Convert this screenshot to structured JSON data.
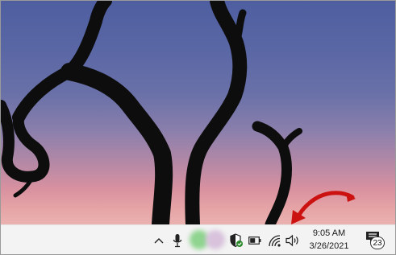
{
  "taskbar": {
    "clock_time": "9:05 AM",
    "clock_date": "3/26/2021",
    "notification_count": "23"
  },
  "icons": {
    "overflow": "chevron-up-icon",
    "microphone": "microphone-icon",
    "security": "shield-icon",
    "battery": "battery-icon",
    "network": "wifi-icon",
    "volume": "speaker-icon",
    "notifications": "notification-center-icon",
    "annotation": "red-arrow-annotation"
  },
  "colors": {
    "taskbar_bg": "#f3f3f3",
    "annotation_arrow": "#cc1111",
    "security_check": "#2a8a2a"
  }
}
